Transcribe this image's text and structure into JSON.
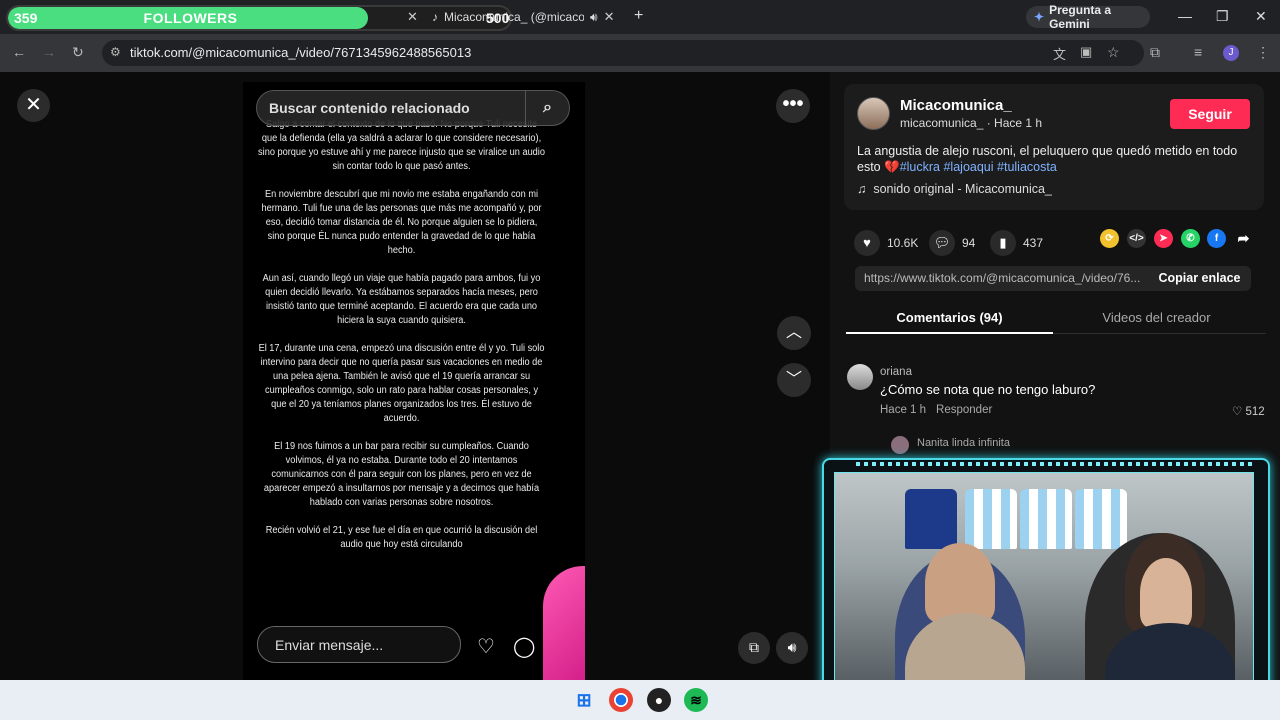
{
  "browser": {
    "followers_overlay": {
      "current": "359",
      "label": "FOLLOWERS",
      "goal": "500",
      "progress_fraction": 0.718
    },
    "tab_title": "Micacomunica_ (@micacom",
    "gemini_label": "Pregunta a Gemini",
    "url": "tiktok.com/@micacomunica_/video/7671345962488565013"
  },
  "video": {
    "search_placeholder": "Buscar contenido relacionado",
    "story_paragraphs": [
      "Salgo a contar el contexto de lo que pasó. No porque Tuli necesite que la defienda (ella ya saldrá a aclarar lo que considere necesario), sino porque yo estuve ahí y me parece injusto que se viralice un audio sin contar todo lo que pasó antes.",
      "En noviembre descubrí que mi novio me estaba engañando con mi hermano. Tuli fue una de las personas que más me acompañó y, por eso, decidió tomar distancia de él. No porque alguien se lo pidiera, sino porque ÉL nunca pudo entender la gravedad de lo que había hecho.",
      "Aun así, cuando llegó un viaje que había pagado para ambos, fui yo quien decidió llevarlo. Ya estábamos separados hacía meses, pero insistió tanto que terminé aceptando. El acuerdo era que cada uno hiciera la suya cuando quisiera.",
      "El 17, durante una cena, empezó una discusión entre él y yo. Tuli solo intervino para decir que no quería pasar sus vacaciones en medio de una pelea ajena. También le avisó que el 19 quería arrancar su cumpleaños conmigo, solo un rato para hablar cosas personales, y que el 20 ya teníamos planes organizados los tres. Él estuvo de acuerdo.",
      "El 19 nos fuimos a un bar para recibir su cumpleaños. Cuando volvimos, él ya no estaba. Durante todo el 20 intentamos comunicarnos con él para seguir con los planes, pero en vez de aparecer empezó a insultarnos por mensaje y a decirnos que había hablado con varias personas sobre nosotros.",
      "Recién volvió el 21, y ese fue el día en que ocurrió la discusión del audio que hoy está circulando"
    ],
    "message_placeholder": "Enviar mensaje..."
  },
  "post": {
    "display_name": "Micacomunica_",
    "handle": "micacomunica_",
    "time": "Hace 1 h",
    "follow_label": "Seguir",
    "description": "La angustia de alejo rusconi, el peluquero que quedó metido en todo esto",
    "emoji": "💔",
    "hashtags": [
      "#luckra",
      "#lajoaqui",
      "#tuliacosta"
    ],
    "sound": "sonido original - Micacomunica_",
    "likes": "10.6K",
    "comments_count": "94",
    "saves": "437",
    "share_link": "https://www.tiktok.com/@micacomunica_/video/76...",
    "copy_label": "Copiar enlace",
    "tab_comments": "Comentarios (94)",
    "tab_creator": "Videos del creador"
  },
  "comments": [
    {
      "user": "oriana",
      "text": "¿Cómo se nota que no tengo laburo?",
      "time": "Hace 1 h",
      "reply_label": "Responder",
      "likes": "512"
    },
    {
      "user": "Nanita linda infinita"
    }
  ],
  "colors": {
    "accent": "#fe2c55",
    "hashtag": "#7fb2ff",
    "overlay_green": "#4ade80",
    "cam_border": "#4ad8e6"
  }
}
